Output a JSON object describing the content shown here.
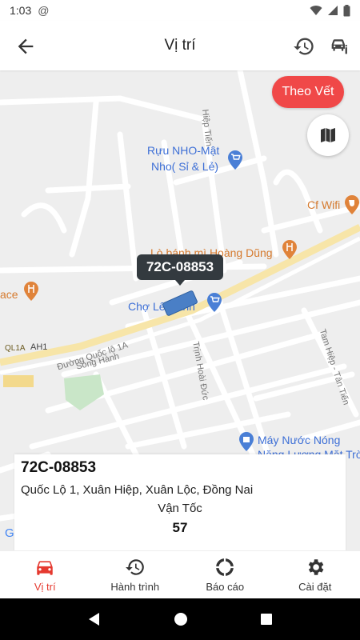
{
  "status_bar": {
    "time": "1:03",
    "at_symbol": "@"
  },
  "header": {
    "title": "Vị trí"
  },
  "map": {
    "follow_button": "Theo Vết",
    "labels": {
      "hiep_tien": "Hiệp Tiến",
      "ruou_line1": "Rựu NHO-Mật",
      "ruou_line2": "Nho( Sỉ & Lẻ)",
      "cf_wifi": "Cf Wifi",
      "lo_banh_mi": "Lò bánh mì Hoàng Dũng",
      "cho": "Chợ Lê Hành",
      "ace": "ace",
      "quoc_lo": "Đường Quốc lộ 1A",
      "ah1": "AH1",
      "ql1a": "QL1A",
      "song_hanh": "Song Hành",
      "trinh_hoai_duc": "Trịnh Hoài Đức",
      "tam_hiep": "Tam Hiệp - Tân Tiến",
      "may_nuoc_line1": "Máy Nước Nóng",
      "may_nuoc_line2": "Năng Lượng Mặt Trời"
    }
  },
  "vehicle": {
    "plate": "72C-08853",
    "address": "Quốc Lộ 1, Xuân Hiệp, Xuân Lộc, Đồng Nai",
    "speed_label": "Vận Tốc",
    "speed": "57"
  },
  "bottom_nav": [
    {
      "label": "Vị trí",
      "icon": "car-icon",
      "active": true
    },
    {
      "label": "Hành trình",
      "icon": "history-icon",
      "active": false
    },
    {
      "label": "Báo cáo",
      "icon": "report-icon",
      "active": false
    },
    {
      "label": "Cài đặt",
      "icon": "gear-icon",
      "active": false
    }
  ],
  "colors": {
    "accent": "#e5392f",
    "follow_button": "#f04848",
    "main_road": "#f7e5a8",
    "map_bg": "#eeeeee"
  }
}
